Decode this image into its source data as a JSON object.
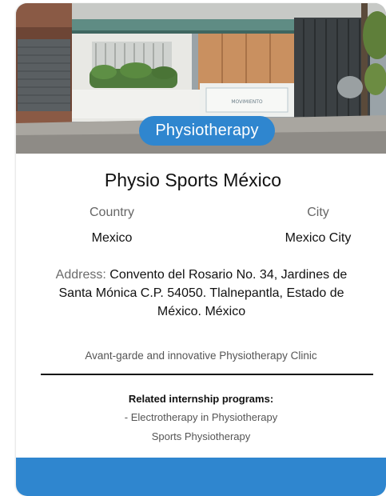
{
  "clinic": {
    "category": "Physiotherapy",
    "name": "Physio Sports México",
    "country_label": "Country",
    "country": "Mexico",
    "city_label": "City",
    "city": "Mexico City",
    "address_label": "Address:",
    "address": "Convento del Rosario No. 34, Jardines de Santa Mónica C.P. 54050. Tlalnepantla, Estado de México. México",
    "description": "Avant-garde and innovative Physiotherapy Clinic"
  },
  "programs": {
    "heading": "Related internship programs:",
    "items": [
      "- Electrotherapy in Physiotherapy",
      "Sports Physiotherapy"
    ]
  },
  "colors": {
    "accent": "#2f86cf",
    "text": "#111111",
    "muted": "#666666"
  },
  "photo": {
    "sign_text": "MOVIMIENTO"
  }
}
